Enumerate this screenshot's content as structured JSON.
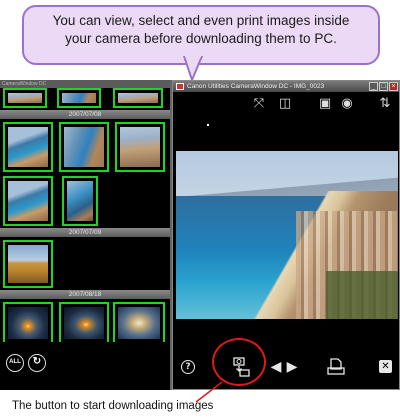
{
  "callout": {
    "line1": "You can view, select and even print images inside",
    "line2": "your camera before downloading them to PC."
  },
  "left_window": {
    "title": "CameraWindow DC",
    "date_groups": [
      "2007/07/08",
      "2007/07/09",
      "2007/08/18"
    ],
    "footer_icons": {
      "all": "ALL",
      "all_icon": "select-all-icon",
      "rotate_icon": "rotate-icon"
    }
  },
  "viewer": {
    "title": "Canon Utilities CameraWindow DC - IMG_0023",
    "window_buttons": [
      "_",
      "□",
      "×"
    ],
    "toolbar_icons": [
      "fit-screen-icon",
      "split-view-icon",
      "camera-select-icon",
      "camera-settings-icon",
      "transfer-settings-icon"
    ],
    "bottom_icons": {
      "help": "?",
      "download": "download-icon",
      "prev": "◀",
      "next": "▶",
      "print": "print-icon",
      "close": "✕"
    }
  },
  "caption": {
    "text": "The button to start downloading images"
  },
  "colors": {
    "callout_bg": "#ecd9f5",
    "callout_border": "#9a73c9",
    "thumb_border": "#22d422",
    "highlight": "#e01818"
  }
}
